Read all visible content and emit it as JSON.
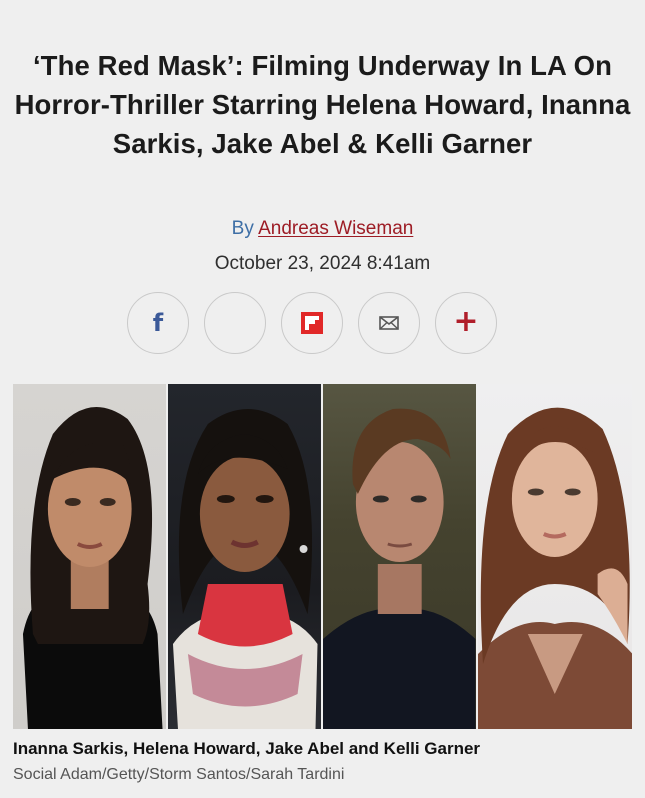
{
  "article": {
    "headline": "‘The Red Mask’: Filming Underway In LA On Horror-Thriller Starring Helena Howard, Inanna Sarkis, Jake Abel  & Kelli Garner",
    "by_prefix": "By",
    "author": "Andreas Wiseman",
    "date": "October 23, 2024 8:41am"
  },
  "share": {
    "buttons": [
      {
        "name": "facebook",
        "icon": "facebook-icon",
        "glyph": "f"
      },
      {
        "name": "blank",
        "icon": "share-icon",
        "glyph": ""
      },
      {
        "name": "flipboard",
        "icon": "flipboard-icon",
        "glyph": ""
      },
      {
        "name": "email",
        "icon": "email-icon",
        "glyph": ""
      },
      {
        "name": "more",
        "icon": "plus-icon",
        "glyph": "+"
      }
    ]
  },
  "image": {
    "caption": "Inanna Sarkis, Helena Howard, Jake Abel and Kelli Garner",
    "credit": "Social Adam/Getty/Storm Santos/Sarah Tardini"
  },
  "colors": {
    "background": "#efefef",
    "author_link": "#9d1c25",
    "byline": "#3e6fa6",
    "facebook": "#3b5998",
    "accent_red": "#b01e2a"
  }
}
